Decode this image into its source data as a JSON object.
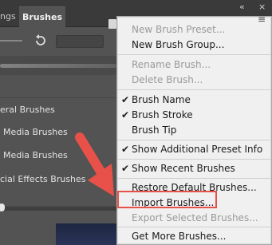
{
  "panel": {
    "tabs": [
      {
        "label": "ngs"
      },
      {
        "label": "Brushes"
      }
    ],
    "collapse_glyph": "«",
    "close_glyph": "×",
    "menu_glyph": "≡",
    "reset_icon": "reset-icon",
    "groups": [
      {
        "label": "eral Brushes"
      },
      {
        "label": "Media Brushes"
      },
      {
        "label": "Media Brushes"
      },
      {
        "label": "cial Effects Brushes"
      }
    ]
  },
  "menu": {
    "items": [
      {
        "label": "New Brush Preset...",
        "disabled": true,
        "checked": false
      },
      {
        "label": "New Brush Group...",
        "disabled": false,
        "checked": false
      },
      {
        "label": "Rename Brush...",
        "disabled": true,
        "checked": false
      },
      {
        "label": "Delete Brush...",
        "disabled": true,
        "checked": false
      },
      {
        "label": "Brush Name",
        "disabled": false,
        "checked": true
      },
      {
        "label": "Brush Stroke",
        "disabled": false,
        "checked": true
      },
      {
        "label": "Brush Tip",
        "disabled": false,
        "checked": false
      },
      {
        "label": "Show Additional Preset Info",
        "disabled": false,
        "checked": true
      },
      {
        "label": "Show Recent Brushes",
        "disabled": false,
        "checked": true
      },
      {
        "label": "Restore Default Brushes...",
        "disabled": false,
        "checked": false
      },
      {
        "label": "Import Brushes...",
        "disabled": false,
        "checked": false
      },
      {
        "label": "Export Selected Brushes...",
        "disabled": true,
        "checked": false
      },
      {
        "label": "Get More Brushes...",
        "disabled": false,
        "checked": false
      }
    ],
    "check_glyph": "✔"
  },
  "colors": {
    "annotation": "#e8514a",
    "panel_bg": "#535353",
    "menu_bg": "#f0f0f0"
  }
}
